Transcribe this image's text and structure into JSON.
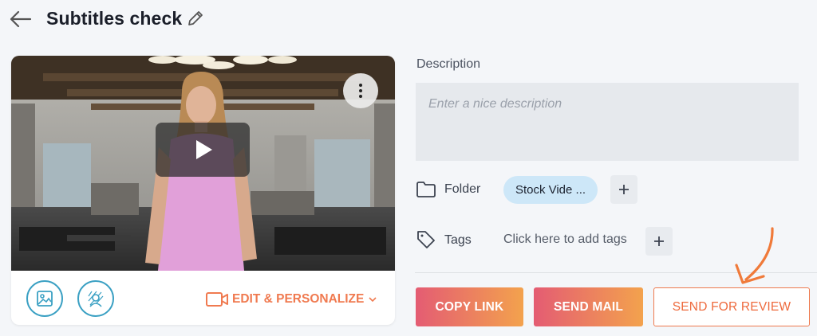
{
  "header": {
    "title": "Subtitles check",
    "back_icon": "arrow-left-icon",
    "edit_icon": "pencil-icon"
  },
  "video": {
    "more_icon": "more-vertical-icon",
    "play_icon": "play-icon",
    "thumbnail_icon": "image-icon",
    "avatar_icon": "avatar-icon",
    "personalize_label": "EDIT & PERSONALIZE",
    "personalize_icon": "video-camera-icon",
    "chevron_icon": "chevron-down-icon"
  },
  "description": {
    "label": "Description",
    "placeholder": "Enter a nice description",
    "value": ""
  },
  "folder": {
    "label": "Folder",
    "icon": "folder-icon",
    "value": "Stock Vide ...",
    "add_icon": "plus-icon"
  },
  "tags": {
    "label": "Tags",
    "icon": "tag-icon",
    "placeholder": "Click here to add tags",
    "add_icon": "plus-icon"
  },
  "actions": {
    "copy_link": "COPY LINK",
    "send_mail": "SEND MAIL",
    "send_for_review": "SEND FOR REVIEW"
  },
  "colors": {
    "accent_orange": "#f07a50",
    "gradient_start": "#e45c73",
    "gradient_end": "#f3a24d",
    "chip_blue": "#cde7f8",
    "circle_icon_blue": "#3aa0c3"
  }
}
